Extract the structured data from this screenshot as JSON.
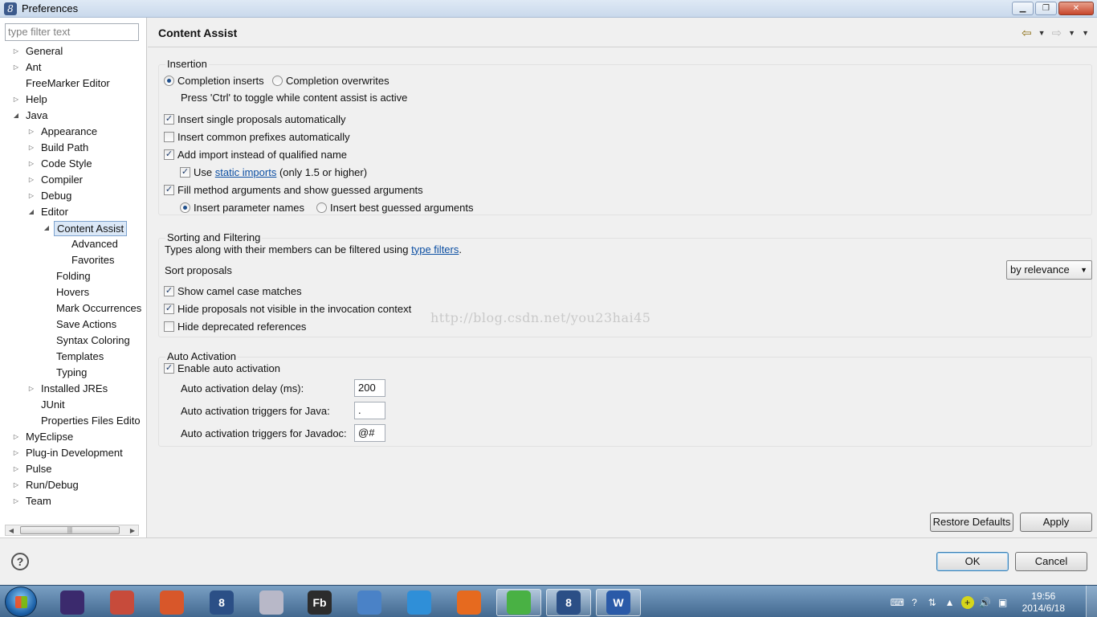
{
  "window": {
    "title": "Preferences"
  },
  "filter": {
    "placeholder": "type filter text"
  },
  "tree": [
    {
      "label": "General",
      "level": 0,
      "toggle": "collapsed"
    },
    {
      "label": "Ant",
      "level": 0,
      "toggle": "collapsed"
    },
    {
      "label": "FreeMarker Editor",
      "level": 0,
      "toggle": "none"
    },
    {
      "label": "Help",
      "level": 0,
      "toggle": "collapsed"
    },
    {
      "label": "Java",
      "level": 0,
      "toggle": "expanded"
    },
    {
      "label": "Appearance",
      "level": 1,
      "toggle": "collapsed"
    },
    {
      "label": "Build Path",
      "level": 1,
      "toggle": "collapsed"
    },
    {
      "label": "Code Style",
      "level": 1,
      "toggle": "collapsed"
    },
    {
      "label": "Compiler",
      "level": 1,
      "toggle": "collapsed"
    },
    {
      "label": "Debug",
      "level": 1,
      "toggle": "collapsed"
    },
    {
      "label": "Editor",
      "level": 1,
      "toggle": "expanded"
    },
    {
      "label": "Content Assist",
      "level": 2,
      "toggle": "expanded",
      "selected": true
    },
    {
      "label": "Advanced",
      "level": 3,
      "toggle": "none"
    },
    {
      "label": "Favorites",
      "level": 3,
      "toggle": "none"
    },
    {
      "label": "Folding",
      "level": 2,
      "toggle": "none"
    },
    {
      "label": "Hovers",
      "level": 2,
      "toggle": "none"
    },
    {
      "label": "Mark Occurrences",
      "level": 2,
      "toggle": "none"
    },
    {
      "label": "Save Actions",
      "level": 2,
      "toggle": "none"
    },
    {
      "label": "Syntax Coloring",
      "level": 2,
      "toggle": "none"
    },
    {
      "label": "Templates",
      "level": 2,
      "toggle": "none"
    },
    {
      "label": "Typing",
      "level": 2,
      "toggle": "none"
    },
    {
      "label": "Installed JREs",
      "level": 1,
      "toggle": "collapsed"
    },
    {
      "label": "JUnit",
      "level": 1,
      "toggle": "none"
    },
    {
      "label": "Properties Files Edito",
      "level": 1,
      "toggle": "none"
    },
    {
      "label": "MyEclipse",
      "level": 0,
      "toggle": "collapsed"
    },
    {
      "label": "Plug-in Development",
      "level": 0,
      "toggle": "collapsed"
    },
    {
      "label": "Pulse",
      "level": 0,
      "toggle": "collapsed"
    },
    {
      "label": "Run/Debug",
      "level": 0,
      "toggle": "collapsed"
    },
    {
      "label": "Team",
      "level": 0,
      "toggle": "collapsed"
    }
  ],
  "page": {
    "title": "Content Assist",
    "insertion": {
      "title": "Insertion",
      "completion_inserts": {
        "label": "Completion inserts",
        "checked": true
      },
      "completion_overwrites": {
        "label": "Completion overwrites",
        "checked": false
      },
      "toggle_hint": "Press 'Ctrl' to toggle while content assist is active",
      "insert_single": {
        "label": "Insert single proposals automatically",
        "checked": true
      },
      "insert_common": {
        "label": "Insert common prefixes automatically",
        "checked": false
      },
      "add_import": {
        "label": "Add import instead of qualified name",
        "checked": true
      },
      "use_static": {
        "prefix": "Use",
        "link": "static imports",
        "suffix": "(only 1.5 or higher)",
        "checked": true
      },
      "fill_method": {
        "label": "Fill method arguments and show guessed arguments",
        "checked": true
      },
      "insert_param_names": {
        "label": "Insert parameter names",
        "checked": true
      },
      "insert_best_guessed": {
        "label": "Insert best guessed arguments",
        "checked": false
      }
    },
    "sorting": {
      "title": "Sorting and Filtering",
      "types_text": "Types along with their members can be filtered using",
      "types_link": "type filters",
      "types_end": ".",
      "sort_label": "Sort proposals",
      "sort_value": "by relevance",
      "camel_case": {
        "label": "Show camel case matches",
        "checked": true
      },
      "hide_not_visible": {
        "label": "Hide proposals not visible in the invocation context",
        "checked": true
      },
      "hide_deprecated": {
        "label": "Hide deprecated references",
        "checked": false
      }
    },
    "auto": {
      "title": "Auto Activation",
      "enable": {
        "label": "Enable auto activation",
        "checked": true
      },
      "delay_label": "Auto activation delay (ms):",
      "delay_value": "200",
      "java_label": "Auto activation triggers for Java:",
      "java_value": ".",
      "javadoc_label": "Auto activation triggers for Javadoc:",
      "javadoc_value": "@#"
    },
    "watermark": "http://blog.csdn.net/you23hai45"
  },
  "buttons": {
    "restore_defaults": "Restore Defaults",
    "apply": "Apply",
    "ok": "OK",
    "cancel": "Cancel"
  },
  "taskbar": {
    "apps": [
      {
        "name": "eclipse-icon",
        "glyph": "",
        "color": "#3b2a6d"
      },
      {
        "name": "paint-icon",
        "glyph": "",
        "color": "#c74b3b"
      },
      {
        "name": "matlab-icon",
        "glyph": "",
        "color": "#d8572a"
      },
      {
        "name": "myeclipse-icon",
        "glyph": "8",
        "color": "#2b4f86"
      },
      {
        "name": "scissors-icon",
        "glyph": "",
        "color": "#b8b8c8"
      },
      {
        "name": "flashbuilder-icon",
        "glyph": "Fb",
        "color": "#2c2c2c"
      },
      {
        "name": "virtualbox-icon",
        "glyph": "",
        "color": "#4a82c7"
      },
      {
        "name": "cloud-icon",
        "glyph": "",
        "color": "#2f8fd8"
      },
      {
        "name": "firefox-icon",
        "glyph": "",
        "color": "#e66a1f"
      },
      {
        "name": "sync-icon",
        "glyph": "",
        "color": "#49b144",
        "active": true
      },
      {
        "name": "myeclipse-active-icon",
        "glyph": "8",
        "color": "#2b4f86",
        "active": true
      },
      {
        "name": "word-icon",
        "glyph": "W",
        "color": "#2a5aa8",
        "active": true
      }
    ],
    "time": "19:56",
    "date": "2014/6/18"
  }
}
